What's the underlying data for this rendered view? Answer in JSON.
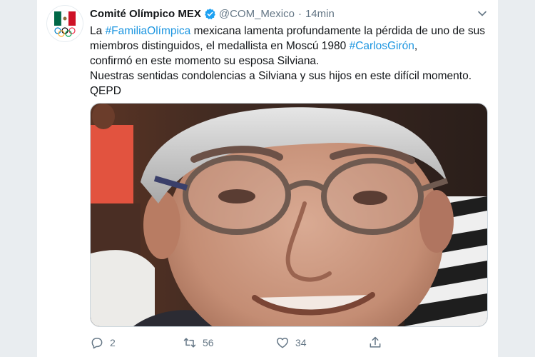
{
  "author": {
    "display_name": "Comité Olímpico MEX",
    "handle": "@COM_Mexico",
    "separator": "·",
    "time": "14min",
    "verified": true,
    "avatar_icon": "mexican-flag-olympic-rings-icon"
  },
  "tweet": {
    "p1": "La ",
    "tag1": "#FamiliaOlímpica",
    "p2": " mexicana lamenta profundamente la pérdida de uno de sus miembros distinguidos, el medallista en Moscú 1980 ",
    "tag2": "#CarlosGirón",
    "p3": ",",
    "line2": "confirmó en este momento su esposa Silviana.",
    "line3": "Nuestras sentidas condolencias a Silviana y sus hijos en este difícil momento.",
    "line4": "QEPD"
  },
  "media": {
    "icon": "photo-man-with-glasses"
  },
  "actions": {
    "replies": "2",
    "retweets": "56",
    "likes": "34"
  },
  "colors": {
    "link": "#1b95e0",
    "verified": "#1da1f2",
    "muted": "#657786"
  }
}
